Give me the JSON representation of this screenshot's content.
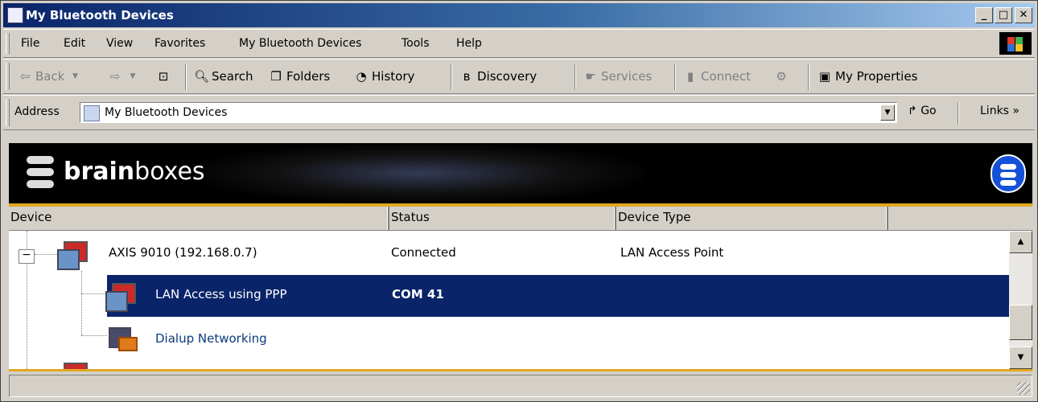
{
  "window": {
    "title": "My Bluetooth Devices",
    "controls": {
      "minimize": "_",
      "maximize": "□",
      "close": "✕"
    }
  },
  "menubar": {
    "items": [
      "File",
      "Edit",
      "View",
      "Favorites",
      "My Bluetooth Devices",
      "Tools",
      "Help"
    ]
  },
  "toolbar": {
    "back": "Back",
    "search": "Search",
    "folders": "Folders",
    "history": "History",
    "discovery": "Discovery",
    "services": "Services",
    "connect": "Connect",
    "my_properties": "My Properties"
  },
  "address": {
    "label": "Address",
    "value": "My Bluetooth Devices",
    "go": "Go",
    "links": "Links",
    "links_chevron": "»"
  },
  "banner": {
    "brand_bold": "brain",
    "brand_regular": "boxes",
    "accent_color": "#e1a821"
  },
  "columns": {
    "device": "Device",
    "status": "Status",
    "device_type": "Device Type"
  },
  "rows": [
    {
      "name": "AXIS 9010 (192.168.0.7)",
      "status": "Connected",
      "type": "LAN Access Point",
      "icon": "network-computer-icon"
    },
    {
      "name": "LAN Access using PPP",
      "status": "COM 41",
      "type": "",
      "icon": "network-computer-icon",
      "selected": true
    },
    {
      "name": "Dialup Networking",
      "status": "",
      "type": "",
      "icon": "dialup-networking-icon"
    }
  ],
  "colors": {
    "selection": "#0a246a",
    "link_text": "#0b3a7e"
  }
}
